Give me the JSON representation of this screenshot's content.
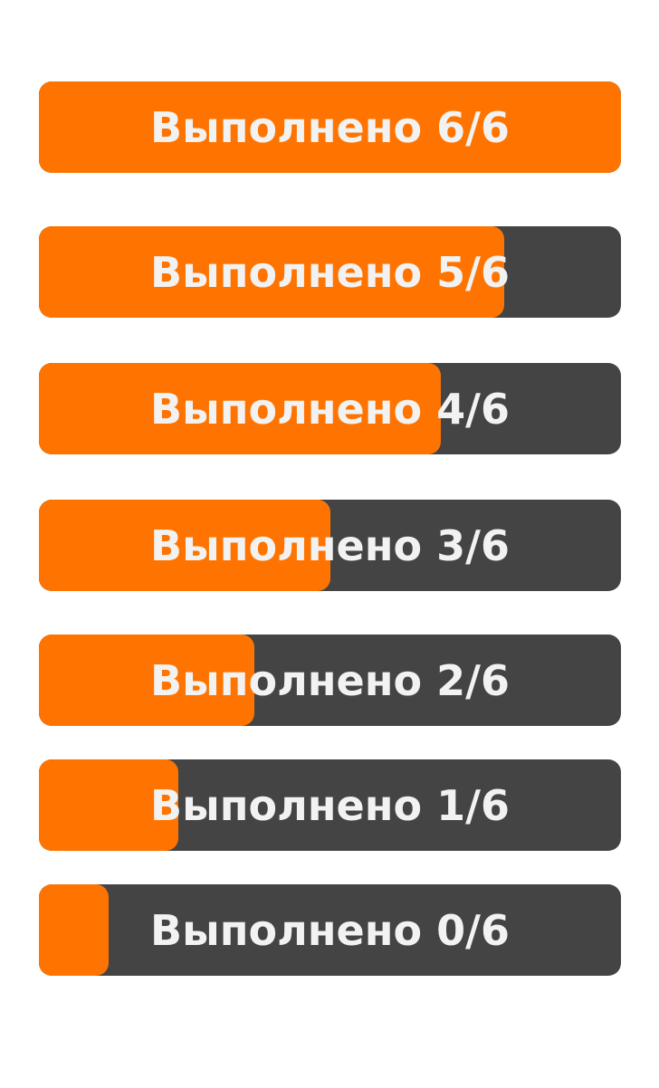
{
  "colors": {
    "track": "#444444",
    "fill": "#ff7400",
    "text": "#f2f2f2"
  },
  "bars": [
    {
      "label": "Выполнено 6/6",
      "progress": 1.0
    },
    {
      "label": "Выполнено 5/6",
      "progress": 0.8
    },
    {
      "label": "Выполнено 4/6",
      "progress": 0.69
    },
    {
      "label": "Выполнено 3/6",
      "progress": 0.5
    },
    {
      "label": "Выполнено 2/6",
      "progress": 0.37
    },
    {
      "label": "Выполнено 1/6",
      "progress": 0.24
    },
    {
      "label": "Выполнено 0/6",
      "progress": 0.12
    }
  ]
}
